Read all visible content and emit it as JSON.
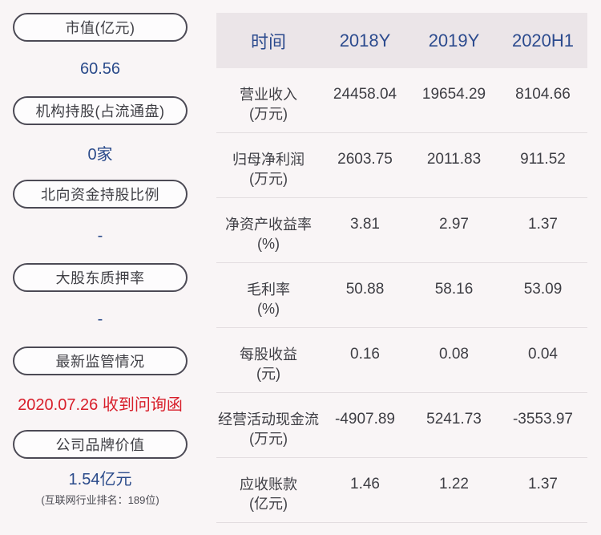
{
  "left": {
    "items": [
      {
        "label": "市值(亿元)",
        "value": "60.56",
        "sub": ""
      },
      {
        "label": "机构持股(占流通盘)",
        "value": "0家",
        "sub": ""
      },
      {
        "label": "北向资金持股比例",
        "value": "-",
        "sub": ""
      },
      {
        "label": "大股东质押率",
        "value": "-",
        "sub": ""
      },
      {
        "label": "最新监管情况",
        "value": "2020.07.26 收到问询函",
        "sub": ""
      },
      {
        "label": "公司品牌价值",
        "value": "1.54亿元",
        "sub": "(互联网行业排名：189位)"
      }
    ],
    "alert_color": "#d81e2a",
    "value_color": "#2a4a8a"
  },
  "table": {
    "header": {
      "time": "时间",
      "cols": [
        "2018Y",
        "2019Y",
        "2020H1"
      ]
    },
    "rows": [
      {
        "label1": "营业收入",
        "label2": "(万元)",
        "values": [
          "24458.04",
          "19654.29",
          "8104.66"
        ]
      },
      {
        "label1": "归母净利润",
        "label2": "(万元)",
        "values": [
          "2603.75",
          "2011.83",
          "911.52"
        ]
      },
      {
        "label1": "净资产收益率",
        "label2": "(%)",
        "values": [
          "3.81",
          "2.97",
          "1.37"
        ]
      },
      {
        "label1": "毛利率",
        "label2": "(%)",
        "values": [
          "50.88",
          "58.16",
          "53.09"
        ]
      },
      {
        "label1": "每股收益",
        "label2": "(元)",
        "values": [
          "0.16",
          "0.08",
          "0.04"
        ]
      },
      {
        "label1": "经营活动现金流",
        "label2": "(万元)",
        "values": [
          "-4907.89",
          "5241.73",
          "-3553.97"
        ]
      },
      {
        "label1": "应收账款",
        "label2": "(亿元)",
        "values": [
          "1.46",
          "1.22",
          "1.37"
        ]
      }
    ]
  }
}
